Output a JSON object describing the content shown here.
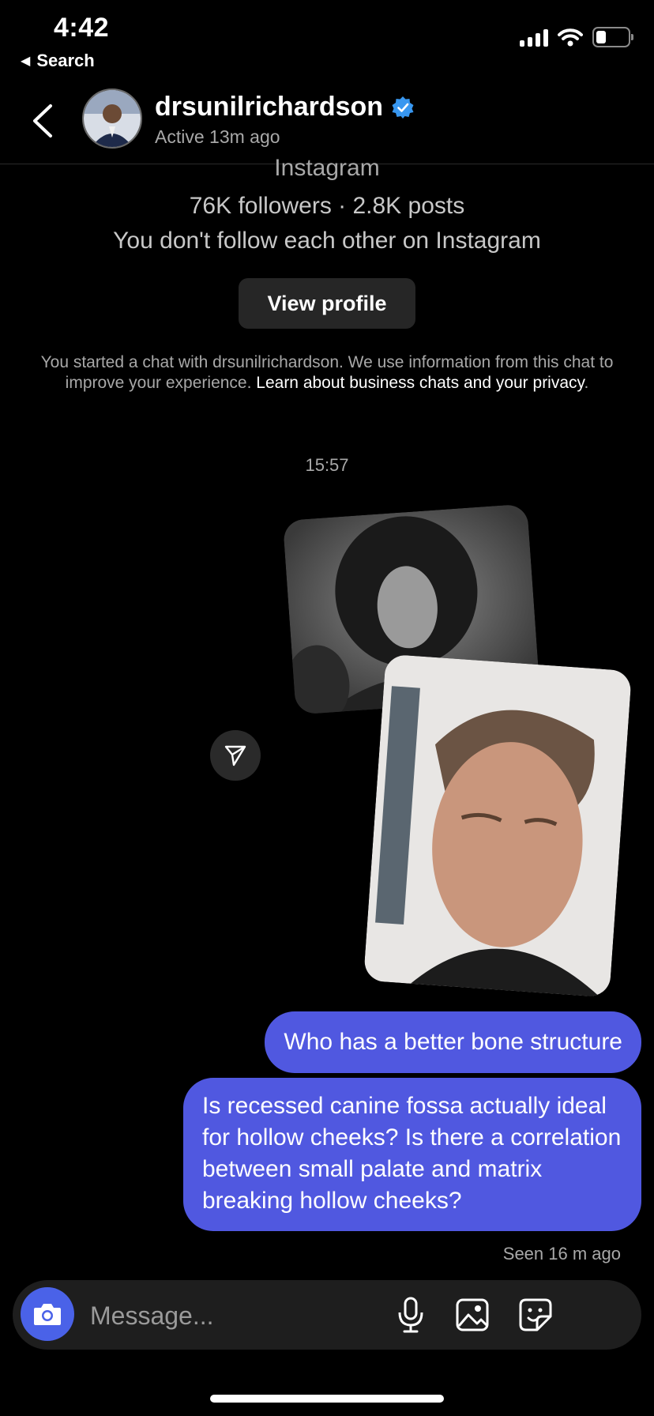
{
  "status_bar": {
    "time": "4:42",
    "back_app_label": "Search",
    "icons": [
      "signal-icon",
      "wifi-icon",
      "battery-icon"
    ]
  },
  "header": {
    "username": "drsunilrichardson",
    "verified": true,
    "active_status": "Active 13m ago"
  },
  "profile_info": {
    "platform": "Instagram",
    "stats": "76K followers · 2.8K posts",
    "follow_status": "You don't follow each other on Instagram",
    "view_profile_label": "View profile"
  },
  "notice": {
    "text": "You started a chat with drsunilrichardson. We use information from this chat to improve your experience. ",
    "link_text": "Learn about business chats and your privacy",
    "suffix": "."
  },
  "chat": {
    "timestamp": "15:57",
    "messages": [
      {
        "from": "me",
        "text": "Who has a better bone structure"
      },
      {
        "from": "me",
        "text": "Is recessed canine fossa actually ideal for hollow cheeks? Is there a correlation between small palate and matrix breaking hollow cheeks?"
      }
    ],
    "seen": "Seen 16 m ago"
  },
  "composer": {
    "placeholder": "Message..."
  },
  "colors": {
    "accent_bubble": "#5058e0",
    "camera_button": "#4a62e8",
    "verified_badge": "#3897f0"
  }
}
